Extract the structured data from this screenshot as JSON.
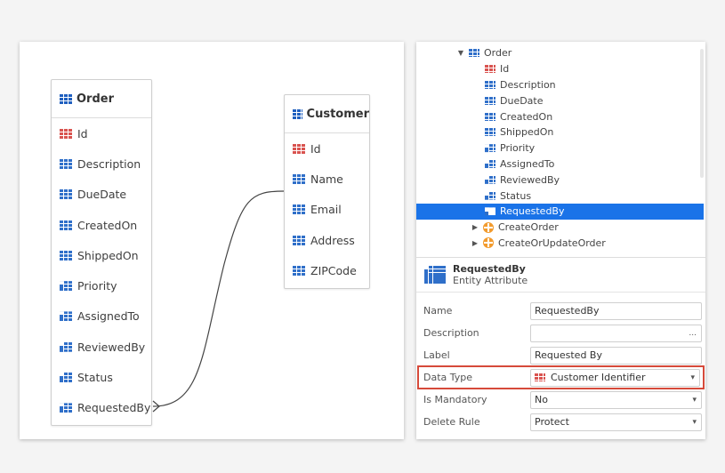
{
  "diagram": {
    "order": {
      "title": "Order",
      "attributes": [
        {
          "label": "Id",
          "icon": "primary-key-icon"
        },
        {
          "label": "Description",
          "icon": "attribute-icon"
        },
        {
          "label": "DueDate",
          "icon": "attribute-icon"
        },
        {
          "label": "CreatedOn",
          "icon": "attribute-icon"
        },
        {
          "label": "ShippedOn",
          "icon": "attribute-icon"
        },
        {
          "label": "Priority",
          "icon": "foreign-key-icon"
        },
        {
          "label": "AssignedTo",
          "icon": "foreign-key-icon"
        },
        {
          "label": "ReviewedBy",
          "icon": "foreign-key-icon"
        },
        {
          "label": "Status",
          "icon": "foreign-key-icon"
        },
        {
          "label": "RequestedBy",
          "icon": "foreign-key-icon"
        }
      ]
    },
    "customer": {
      "title": "Customer",
      "attributes": [
        {
          "label": "Id",
          "icon": "primary-key-icon"
        },
        {
          "label": "Name",
          "icon": "attribute-icon"
        },
        {
          "label": "Email",
          "icon": "attribute-icon"
        },
        {
          "label": "Address",
          "icon": "attribute-icon"
        },
        {
          "label": "ZIPCode",
          "icon": "attribute-icon"
        }
      ]
    }
  },
  "tree": {
    "root": "Order",
    "items": [
      "Id",
      "Description",
      "DueDate",
      "CreatedOn",
      "ShippedOn",
      "Priority",
      "AssignedTo",
      "ReviewedBy",
      "Status",
      "RequestedBy"
    ],
    "selected": "RequestedBy",
    "actions": [
      "CreateOrder",
      "CreateOrUpdateOrder"
    ]
  },
  "properties": {
    "title": "RequestedBy",
    "subtitle": "Entity Attribute",
    "rows": {
      "name": {
        "label": "Name",
        "value": "RequestedBy"
      },
      "description": {
        "label": "Description",
        "value": "",
        "suffix": "..."
      },
      "label": {
        "label": "Label",
        "value": "Requested By"
      },
      "data_type": {
        "label": "Data Type",
        "value": "Customer Identifier",
        "suffix": "▾"
      },
      "is_mandatory": {
        "label": "Is Mandatory",
        "value": "No",
        "suffix": "▾"
      },
      "delete_rule": {
        "label": "Delete Rule",
        "value": "Protect",
        "suffix": "▾"
      }
    }
  },
  "colors": {
    "selection": "#1a73e8",
    "highlight": "#d64a3a",
    "entity_icon": "#2f6fc9",
    "primary_key_icon": "#d9534f"
  }
}
